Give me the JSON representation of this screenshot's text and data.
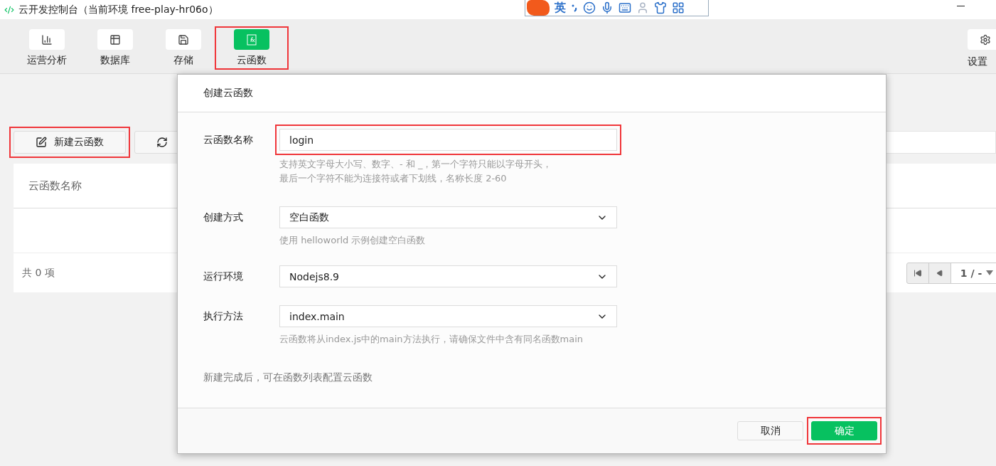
{
  "window": {
    "title": "云开发控制台（当前环境 free-play-hr06o）"
  },
  "ime": {
    "mode": "英"
  },
  "nav": {
    "items": [
      {
        "label": "运营分析",
        "selected": false,
        "highlighted": false
      },
      {
        "label": "数据库",
        "selected": false,
        "highlighted": false
      },
      {
        "label": "存储",
        "selected": false,
        "highlighted": false
      },
      {
        "label": "云函数",
        "selected": true,
        "highlighted": true
      }
    ],
    "settings": {
      "label": "设置"
    }
  },
  "toolbar": {
    "create_button": {
      "label": "新建云函数",
      "highlighted": true
    }
  },
  "table": {
    "columns": [
      "云函数名称"
    ],
    "count": "共 0 项",
    "page": "1 / -"
  },
  "dialog": {
    "title": "创建云函数",
    "fields": [
      {
        "kind": "input",
        "label": "云函数名称",
        "value": "login",
        "highlighted": true,
        "hint": [
          "支持英文字母大小写、数字、- 和 _，第一个字符只能以字母开头，",
          "最后一个字符不能为连接符或者下划线，名称长度 2-60"
        ]
      },
      {
        "kind": "select",
        "label": "创建方式",
        "value": "空白函数",
        "highlighted": false,
        "hint": [
          "使用 helloworld 示例创建空白函数"
        ]
      },
      {
        "kind": "select",
        "label": "运行环境",
        "value": "Nodejs8.9",
        "highlighted": false
      },
      {
        "kind": "select",
        "label": "执行方法",
        "value": "index.main",
        "highlighted": false,
        "hint": [
          "云函数将从index.js中的main方法执行，请确保文件中含有同名函数main"
        ]
      }
    ],
    "note": "新建完成后，可在函数列表配置云函数",
    "buttons": [
      {
        "label": "取消",
        "kind": "secondary",
        "highlighted": false
      },
      {
        "label": "确定",
        "kind": "primary",
        "highlighted": true
      }
    ]
  }
}
